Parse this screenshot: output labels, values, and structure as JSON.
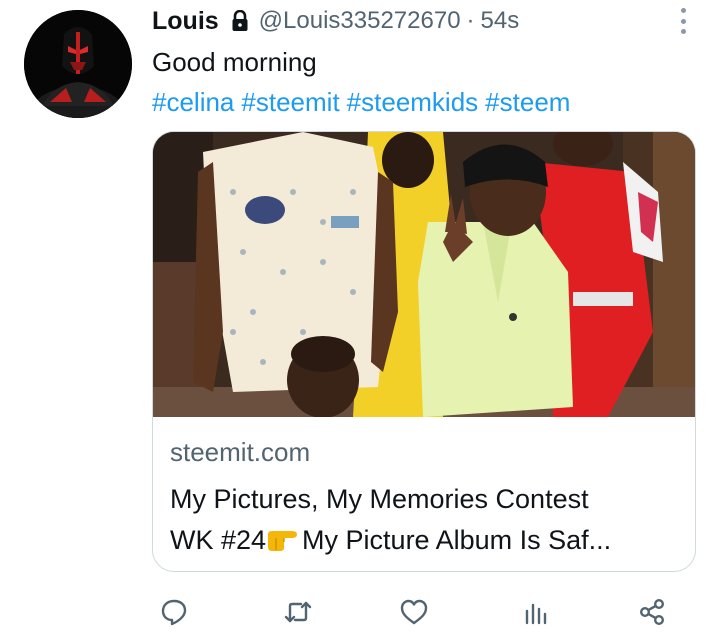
{
  "tweet": {
    "author_name": "Louis",
    "handle": "@Louis335272670",
    "separator": "·",
    "time": "54s",
    "text": "Good morning",
    "hashtags": [
      "#celina",
      "#steemit",
      "#steemkids",
      "#steem"
    ]
  },
  "card": {
    "domain": "steemit.com",
    "title_line1": "My Pictures, My Memories Contest",
    "title_line2_before": "WK #24",
    "title_line2_emoji": "pointing-right-hand-emoji",
    "title_line2_after": "My Picture Album Is Saf..."
  },
  "actions": [
    "reply-icon",
    "retweet-icon",
    "like-icon",
    "views-icon",
    "share-icon"
  ],
  "colors": {
    "link": "#1d9bf0",
    "secondary_text": "#536471",
    "border": "#cfd9de"
  }
}
